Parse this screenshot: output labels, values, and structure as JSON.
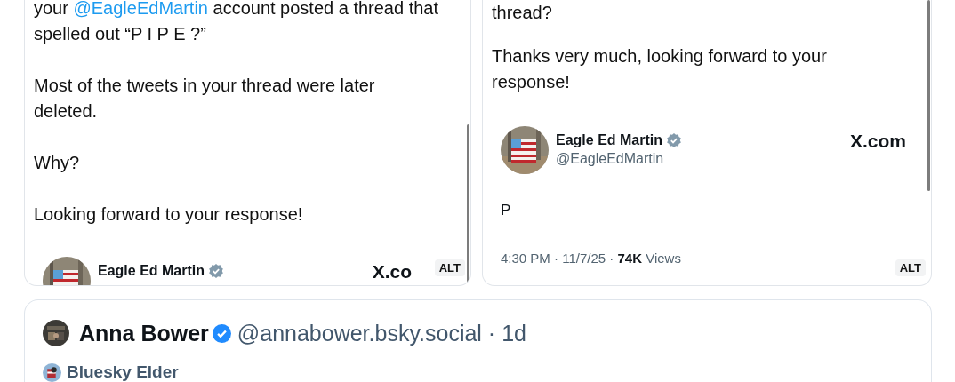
{
  "images": [
    {
      "paragraphs": [
        [
          {
            "pre": "your ",
            "link": "@EagleEdMartin",
            "post": " account posted a thread that"
          },
          {
            "text": "spelled out “P I P E ?”"
          }
        ],
        [
          {
            "text": "Most of the tweets in your thread were later"
          },
          {
            "text": "deleted."
          }
        ],
        [
          {
            "text": "Why?"
          }
        ],
        [
          {
            "text": "Looking forward to your response!"
          }
        ]
      ],
      "embed": {
        "name": "Eagle Ed Martin",
        "verified": true,
        "site": "X.co"
      },
      "alt": "ALT"
    },
    {
      "paragraphs": [
        [
          {
            "text": "thread?"
          }
        ],
        [
          {
            "text": "Thanks very much, looking forward to your"
          },
          {
            "text": "response!"
          }
        ]
      ],
      "embed": {
        "name": "Eagle Ed Martin",
        "verified": true,
        "handle": "@EagleEdMartin",
        "site": "X.com",
        "body": "P",
        "time": "4:30 PM · 11/7/25 · ",
        "views_count": "74K",
        "views_label": " Views"
      },
      "alt": "ALT"
    }
  ],
  "post": {
    "name": "Anna Bower",
    "verified": true,
    "handle": "@annabower.bsky.social · 1d",
    "badge": "Bluesky Elder"
  }
}
